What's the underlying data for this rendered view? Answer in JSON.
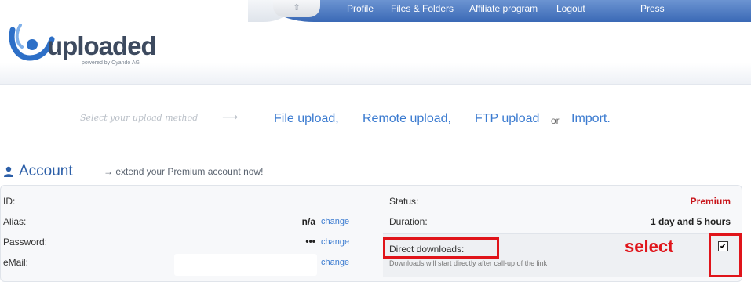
{
  "nav": {
    "home_glyph": "⇧",
    "items": [
      "Profile",
      "Files & Folders",
      "Affiliate program",
      "Logout",
      "Press"
    ]
  },
  "logo": {
    "text": "uploaded",
    "tagline": "powered by Cyando AG"
  },
  "upload": {
    "hint": "Select your upload method",
    "arrow": "⟶",
    "methods": [
      "File upload,",
      "Remote upload,",
      "FTP upload",
      "Import."
    ],
    "or_text": "or"
  },
  "account": {
    "title": "Account",
    "extend_text": "→ extend your Premium account now!",
    "left_rows": [
      {
        "label": "ID:",
        "value": "",
        "change": ""
      },
      {
        "label": "Alias:",
        "value": "n/a",
        "change": "change"
      },
      {
        "label": "Password:",
        "value": "•••",
        "change": "change"
      },
      {
        "label": "eMail:",
        "value": "",
        "change": "change"
      }
    ],
    "status_label": "Status:",
    "status_value": "Premium",
    "duration_label": "Duration:",
    "duration_value": "1 day and 5 hours",
    "direct_label": "Direct downloads:",
    "direct_note": "Downloads will start directly after call-up of the link",
    "direct_checked": true,
    "checkmark": "✔"
  },
  "annotation": {
    "text": "select",
    "color": "#e0141a"
  },
  "colors": {
    "nav_blue": "#3a69b6",
    "link_blue": "#3b7bd0",
    "premium_red": "#c8151b",
    "title_blue": "#2c5fa8"
  }
}
